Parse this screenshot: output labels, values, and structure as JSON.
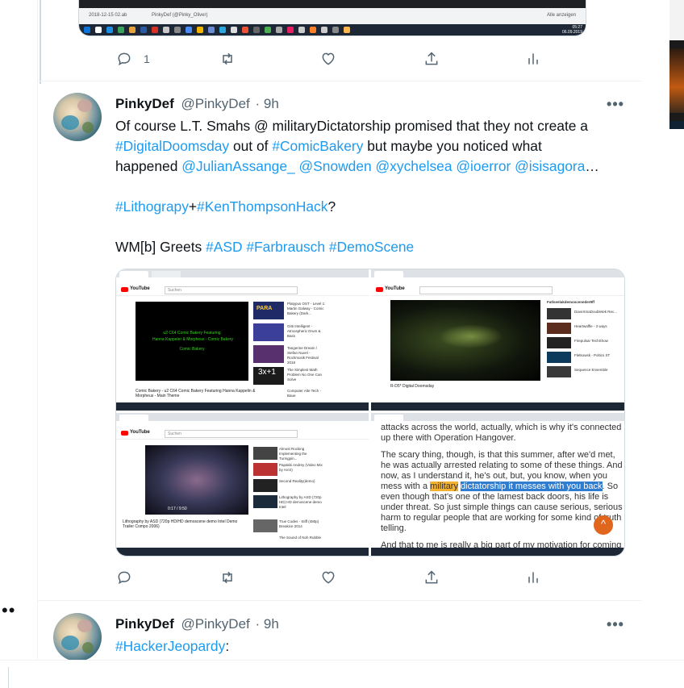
{
  "prev_tweet": {
    "reply_count": "1",
    "taskbar_texts": [
      "2018-12-15 02.ab",
      "PinkyDef (@Pinky_Oliver)",
      "Alle anzeigen",
      "05:27",
      "06.09.2019"
    ]
  },
  "tweet1": {
    "name": "PinkyDef",
    "handle": "@PinkyDef",
    "time": "· 9h",
    "line1": "Of course L.T. Smahs @ militaryDictatorship promised that they not create a",
    "line2_tag1": "#DigitalDoomsday",
    "line2_mid": " out of ",
    "line2_tag2": "#ComicBakery",
    "line2_end": " but maybe you noticed what",
    "line3_start": "happened ",
    "mention1": "@JulianAssange_",
    "mention2": "@Snowden",
    "mention3": "@xychelsea",
    "mention4": "@ioerror",
    "mention5": "@isisagora",
    "ellipsis": "…",
    "tag_litho": "#Lithograpy",
    "plus": "+",
    "tag_ken": "#KenThompsonHack",
    "qmark": "?",
    "wm": "WM[b] Greets ",
    "tag_asd": "#ASD",
    "tag_farb": "#Farbrausch",
    "tag_demo": "#DemoScene",
    "media": {
      "q1": {
        "search": "Suchen",
        "video_lines": [
          "u2 C64 Comic Bakery Featuring",
          "Hanna Kappeler & Morpheus - Comic Bakery",
          "Comic Bakery"
        ],
        "caption": "Comic Bakery - u2 C64 Comic Bakery Featuring Hanna Kappelin & Morpheus - Main Theme",
        "side": [
          "Platypus OST - Level 1: Martin Galway - Comic Bakery (Dark...",
          "Gitti Intelligent - Atmospheric Drum & Bass",
          "Tangerine Dream / Stefan Nuvel - Rockmusik Festival 2018",
          "The Simplest Math Problem No One Can Solve",
          "Computer Alte Tech - Baue"
        ],
        "thumb_text": "3x+1"
      },
      "q2": {
        "caption": "R-D5* Digital Doomsday",
        "side": [
          "Fatlseelakdemosceneder9ff",
          "DaveXmaDoubletek Rec...",
          "Heartwaffle - 3 ways",
          "Firepulsar TechShow",
          "Fletkowsk - Poltics ST",
          "Sequence Ensemble"
        ]
      },
      "q3": {
        "search": "Suchen",
        "caption": "Lithography by ASD (720p HD/HD demoscene demo Intel Demo Trailer Compo 2006)",
        "time": "0:17 / 9:50",
        "side": [
          "Almost Rocking Implementing the Turingpin...",
          "Papakki Andrey (Video Mix by Arctr)",
          "Second Reality(demo)",
          "Lithography by ASD (720p HD) HD demoscene demo Intel",
          "True Codes - Stiff (480p) Breakice 2014",
          "The Sound of Noh Rubble"
        ]
      },
      "q4": {
        "t1": "attacks across the world, actually, which is why it's connected up there with Operation Hangover.",
        "t2a": "The scary thing, though, is that this summer, after we'd met, he was actually arrested relating to some of these things. And now, as I understand it, he's out, but, you know, when you mess with a",
        "t2_hl1": "military",
        "t2_hl2": "dictatorship it messes with you back",
        "t2b": ". So even though that's one of the lamest back doors, his life is under threat. So just simple things can cause serious, serious harm to regular people that are working for some kind of truth telling.",
        "t3": "And that to me is really a big part of my motivation for coming here to talk about what I'm going to talk about next, which is that"
      }
    }
  },
  "tweet2": {
    "name": "PinkyDef",
    "handle": "@PinkyDef",
    "time": "· 9h",
    "tag": "#HackerJeopardy",
    "colon": ":"
  },
  "left": {
    "dots": "••"
  },
  "colors": {
    "accent": "#1d9bf0",
    "muted": "#536471",
    "text": "#0f1419"
  },
  "icons": [
    "reply-icon",
    "retweet-icon",
    "like-icon",
    "share-icon",
    "analytics-icon",
    "more-icon"
  ]
}
